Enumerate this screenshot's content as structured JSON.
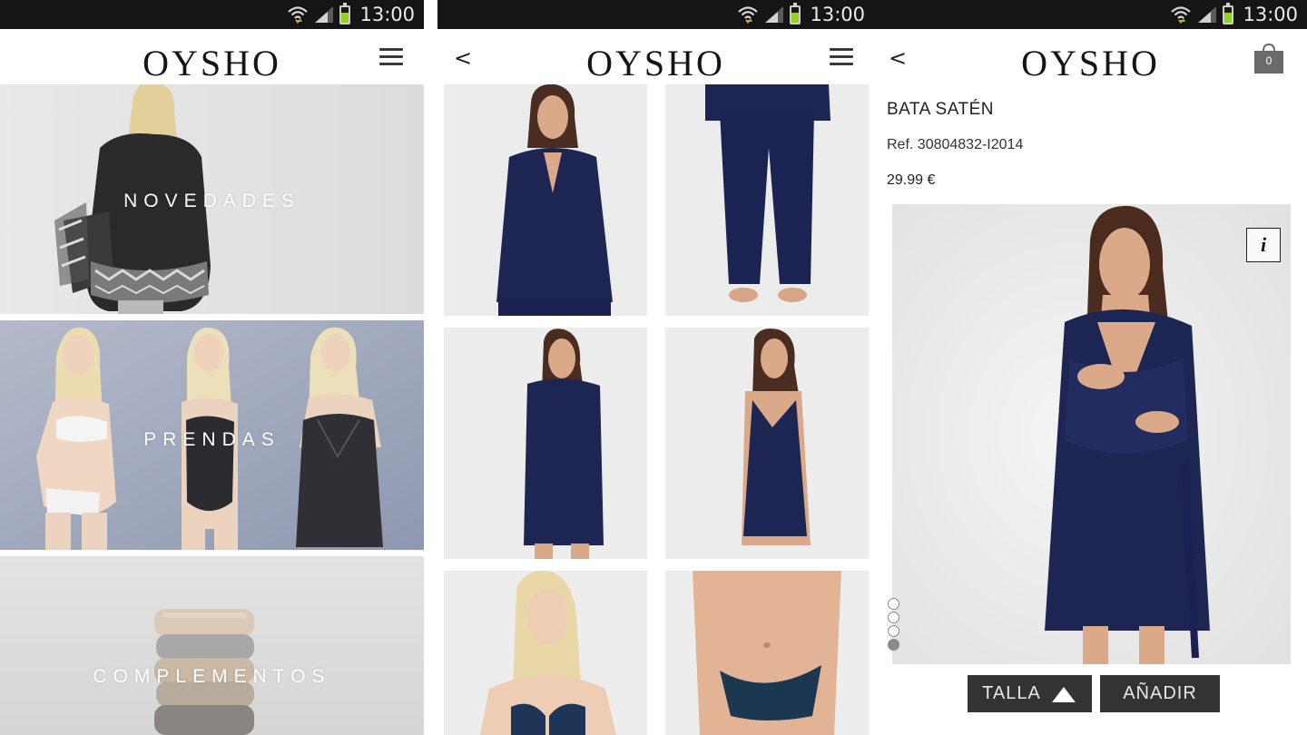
{
  "status_bar": {
    "time": "13:00",
    "battery_color": "#8fd22a"
  },
  "brand": {
    "logo": "OYSHO"
  },
  "icons": {
    "menu": "hamburger-menu-icon",
    "back": "back-chevron-icon",
    "cart": "shopping-bag-icon",
    "info": "info-icon"
  },
  "home": {
    "categories": [
      {
        "label": "NOVEDADES"
      },
      {
        "label": "PRENDAS"
      },
      {
        "label": "COMPLEMENTOS"
      }
    ]
  },
  "listing": {
    "back_label": "<"
  },
  "product": {
    "back_label": "<",
    "cart_count": "0",
    "name": "BATA SATÉN",
    "ref": "Ref. 30804832-I2014",
    "price": "29.99 €",
    "info_label": "i",
    "image_count": 4,
    "active_image": 4,
    "size_button": "TALLA",
    "add_button": "AÑADIR"
  }
}
